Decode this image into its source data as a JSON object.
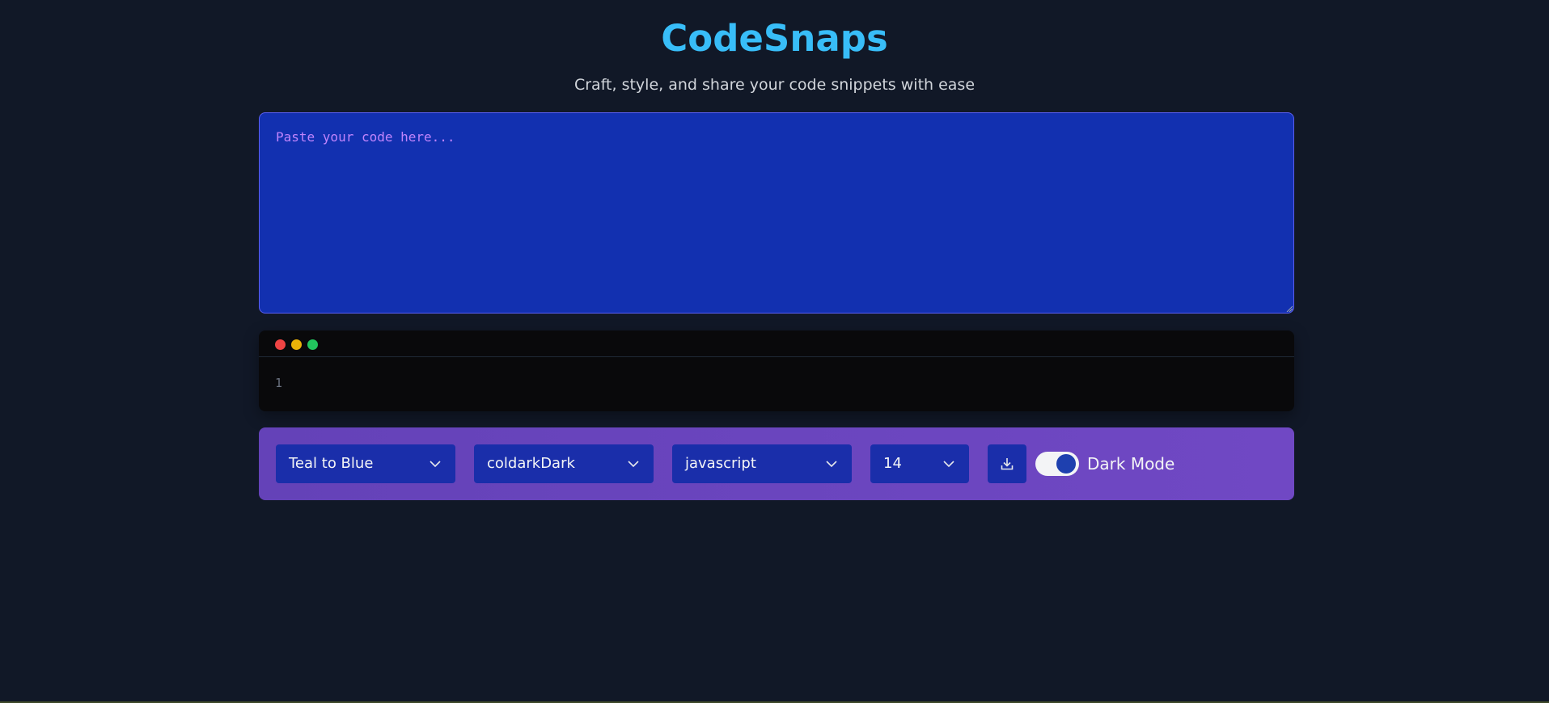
{
  "header": {
    "title": "CodeSnaps",
    "subtitle": "Craft, style, and share your code snippets with ease"
  },
  "editor": {
    "placeholder": "Paste your code here...",
    "value": ""
  },
  "preview": {
    "line_numbers": [
      "1"
    ]
  },
  "toolbar": {
    "background_select": "Teal to Blue",
    "theme_select": "coldarkDark",
    "language_select": "javascript",
    "font_size_select": "14",
    "download_icon": "download-icon",
    "dark_mode": {
      "label": "Dark Mode",
      "enabled": true
    }
  },
  "colors": {
    "title": "#38bdf8",
    "page_background": "#111827",
    "editor_background": "#1230b0",
    "toolbar_background": "#6a45bf",
    "select_background": "#1a2eaa",
    "dot_red": "#ef4444",
    "dot_yellow": "#eab308",
    "dot_green": "#22c55e"
  }
}
